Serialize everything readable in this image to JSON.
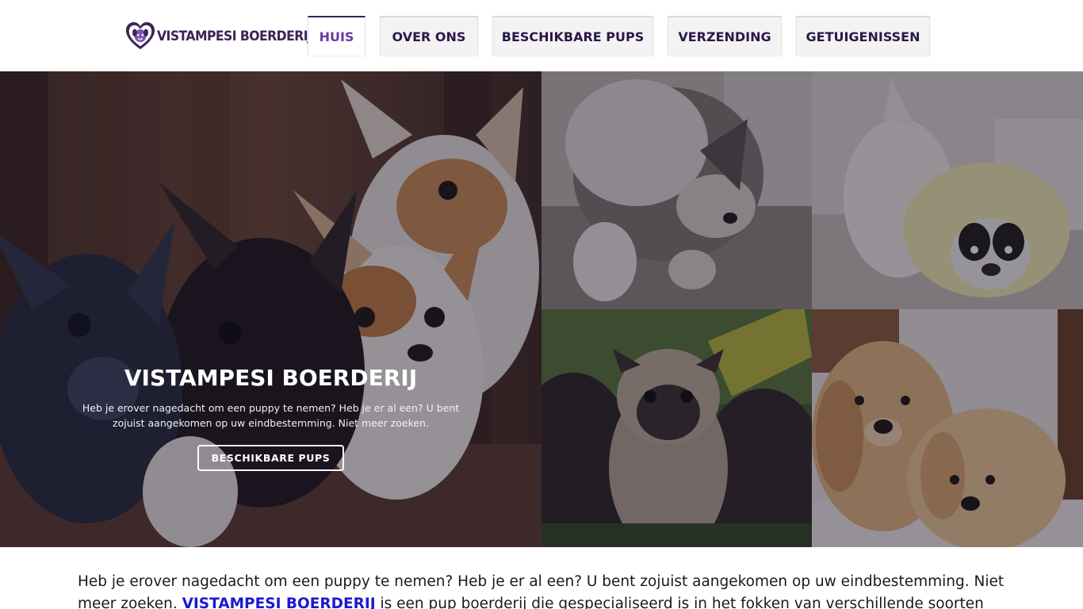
{
  "brand": {
    "name": "VISTAMPESI BOERDERIJ",
    "accent": "#6b3aa0",
    "dark": "#2b1748"
  },
  "nav": {
    "items": [
      {
        "label": "HUIS",
        "active": true
      },
      {
        "label": "OVER ONS",
        "active": false
      },
      {
        "label": "BESCHIKBARE PUPS",
        "active": false
      },
      {
        "label": "VERZENDING",
        "active": false
      },
      {
        "label": "GETUIGENISSEN",
        "active": false
      }
    ]
  },
  "hero": {
    "title": "VISTAMPESI BOERDERIJ",
    "subtitle": "Heb je erover nagedacht om een puppy te nemen? Heb je er al een? U bent zojuist aangekomen op uw eindbestemming. Niet meer zoeken.",
    "button_label": "BESCHIKBARE PUPS",
    "photos": [
      "chihuahua-puppies",
      "husky-dogs",
      "french-bulldogs",
      "pug-puppy",
      "golden-retrievers"
    ]
  },
  "intro": {
    "text_before": "Heb je erover nagedacht om een puppy te nemen? Heb je er al een? U bent zojuist aangekomen op uw eindbestemming. Niet meer zoeken. ",
    "link_text": "VISTAMPESI BOERDERIJ",
    "text_after": " is een pup boerderij die gespecialiseerd is in het fokken van verschillende soorten pups, variërend"
  }
}
